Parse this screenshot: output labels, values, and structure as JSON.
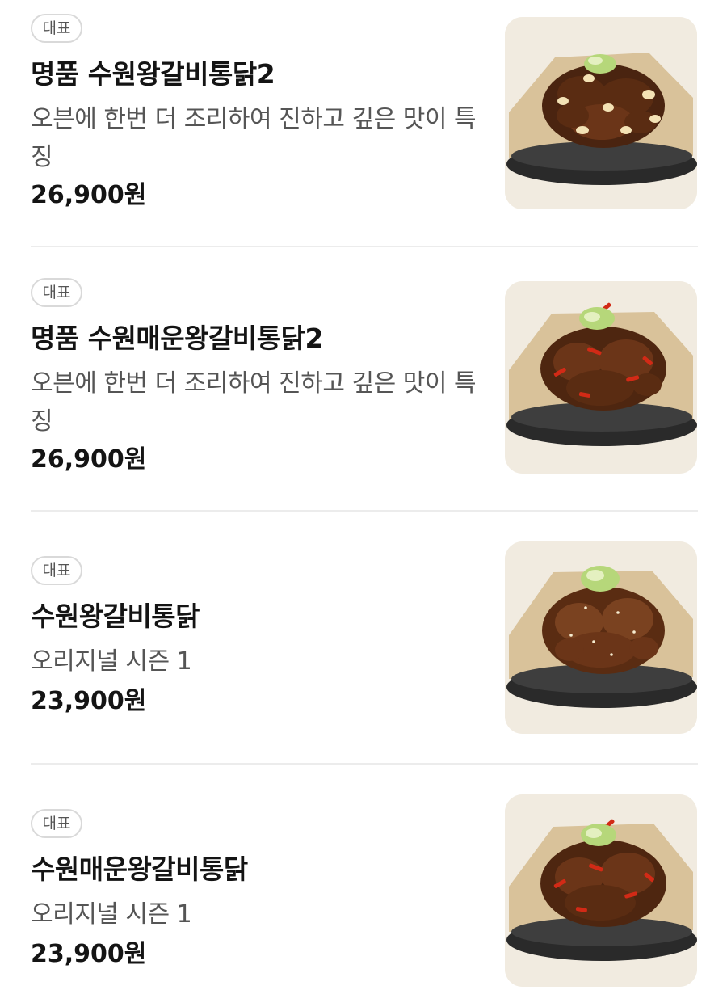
{
  "menu": {
    "items": [
      {
        "badge": "대표",
        "name": "명품 수원왕갈비통닭2",
        "description": "오븐에 한번 더 조리하여 진하고 깊은 맛이 특징",
        "price": "26,900원",
        "image": "garlic-galbi-chicken-photo"
      },
      {
        "badge": "대표",
        "name": "명품 수원매운왕갈비통닭2",
        "description": "오븐에 한번 더 조리하여 진하고 깊은 맛이 특징",
        "price": "26,900원",
        "image": "spicy-galbi-chicken-photo"
      },
      {
        "badge": "대표",
        "name": "수원왕갈비통닭",
        "description": "오리지널 시즌 1",
        "price": "23,900원",
        "image": "galbi-chicken-photo"
      },
      {
        "badge": "대표",
        "name": "수원매운왕갈비통닭",
        "description": "오리지널 시즌 1",
        "price": "23,900원",
        "image": "spicy-galbi-chicken-photo"
      }
    ]
  },
  "colors": {
    "badge_border": "#d9d9d9",
    "divider": "#ececec",
    "thumb_background": "#f1ebe0",
    "parchment": "#d9c29a",
    "chicken": "#5a2c12",
    "pepper": "#d22a16",
    "scallion": "#b6d77a"
  }
}
